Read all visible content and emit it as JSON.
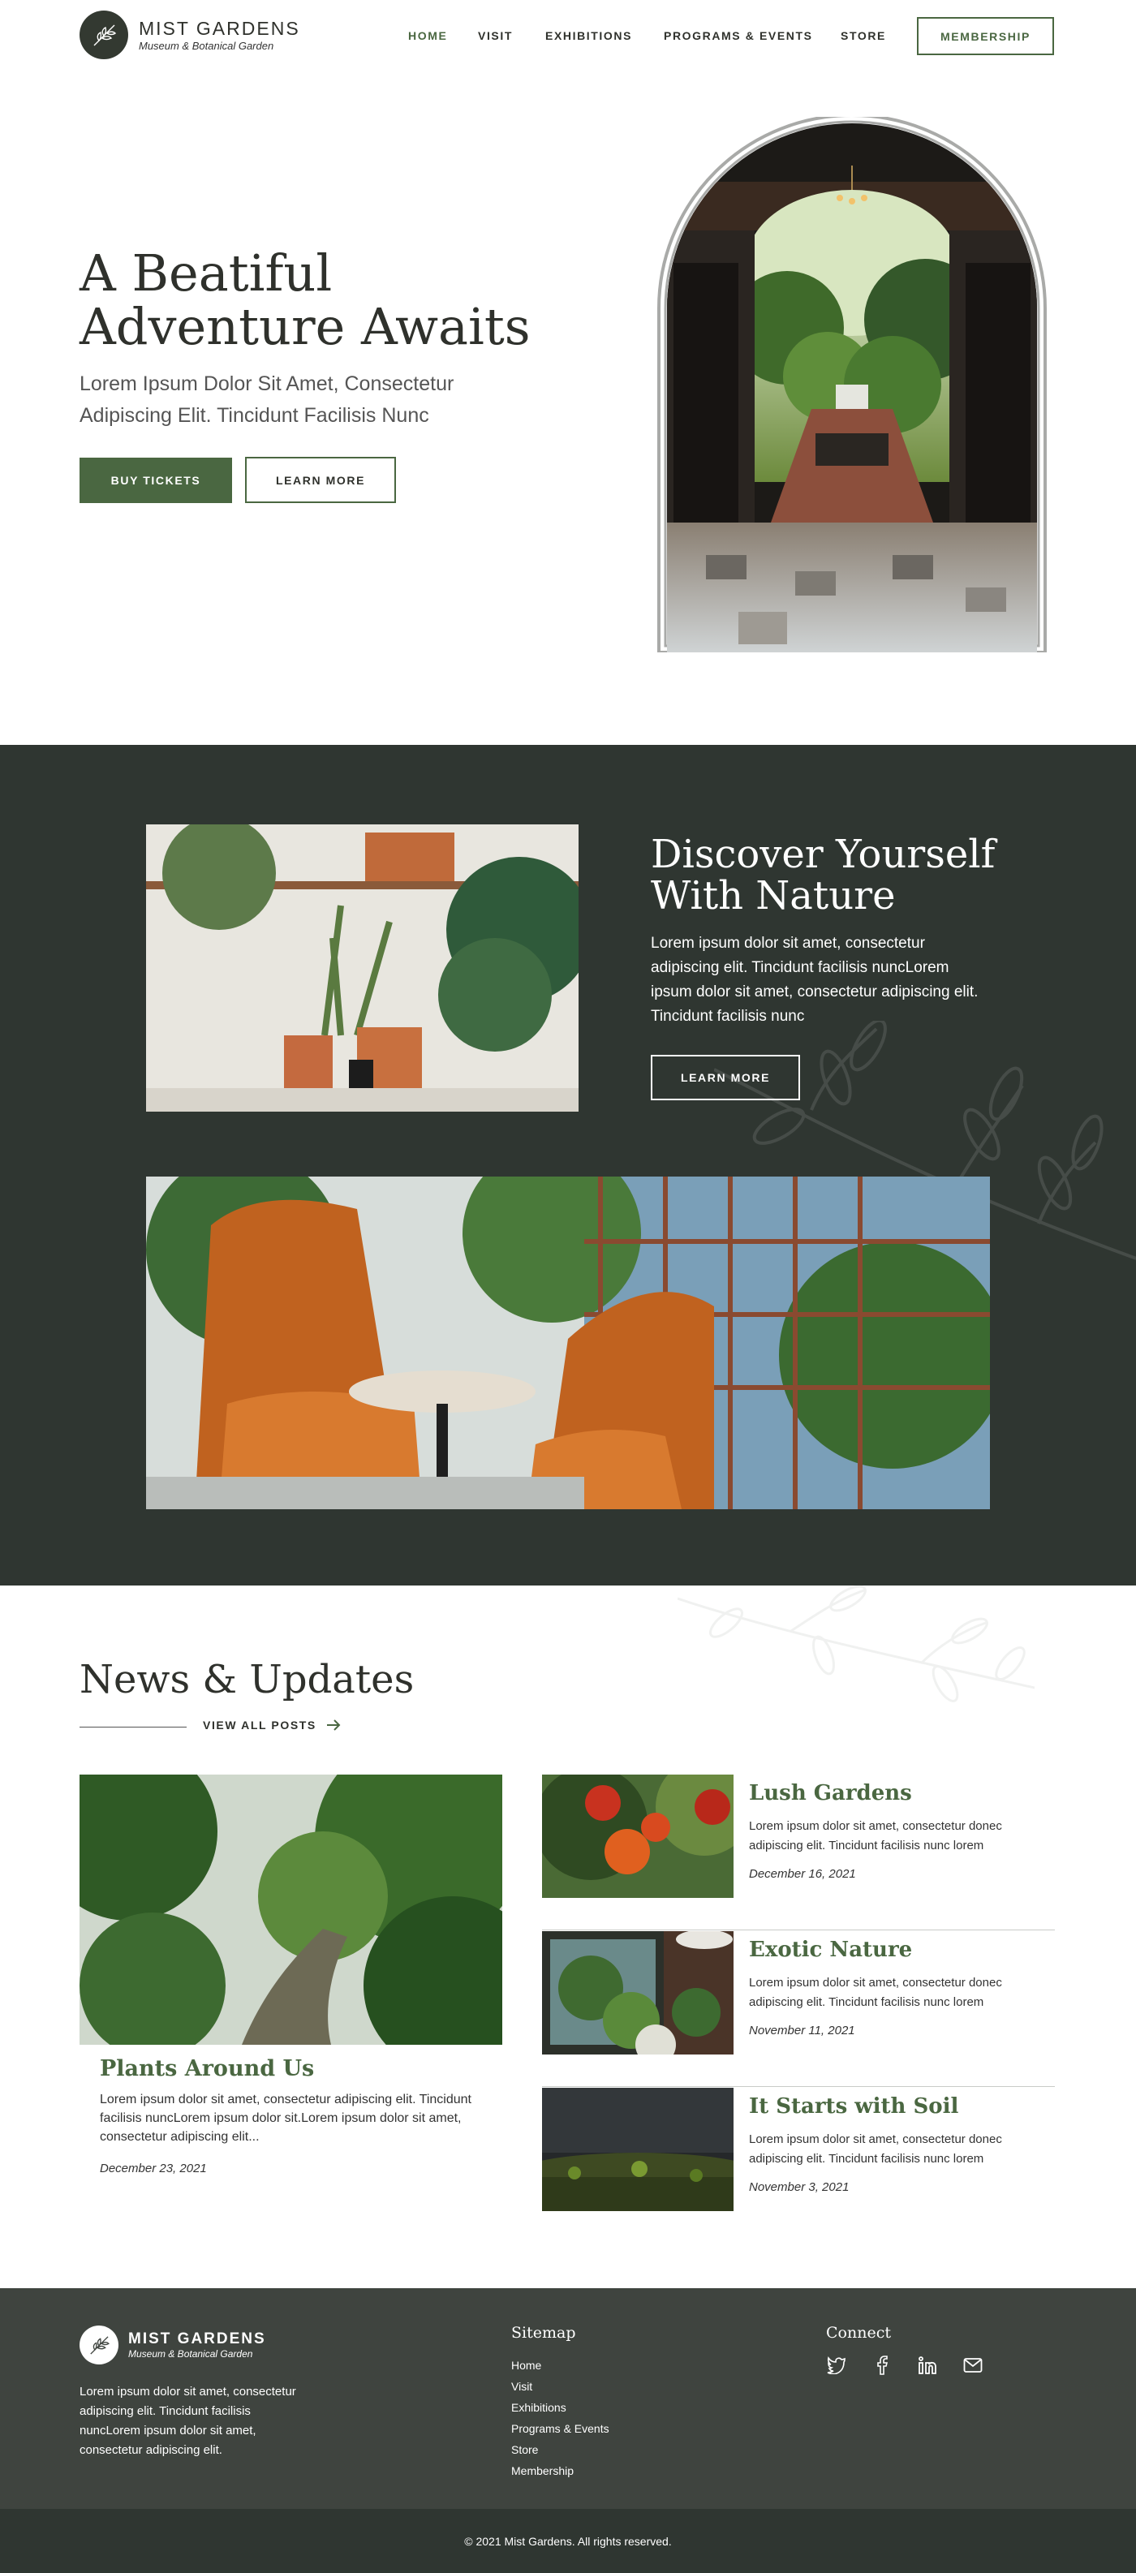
{
  "brand": {
    "name": "MIST GARDENS",
    "tagline": "Museum & Botanical Garden"
  },
  "nav": {
    "items": [
      "HOME",
      "VISIT",
      "EXHIBITIONS",
      "PROGRAMS & EVENTS",
      "STORE"
    ],
    "membership_label": "MEMBERSHIP"
  },
  "hero": {
    "title_line1": "A Beatiful",
    "title_line2": "Adventure Awaits",
    "subtitle": "Lorem Ipsum Dolor Sit Amet, Consectetur Adipiscing Elit. Tincidunt Facilisis Nunc",
    "buy_label": "BUY TICKETS",
    "learn_label": "LEARN MORE"
  },
  "discover": {
    "title_line1": "Discover Yourself",
    "title_line2": "With Nature",
    "text": "Lorem ipsum dolor sit amet, consectetur adipiscing elit. Tincidunt facilisis nuncLorem ipsum dolor sit amet, consectetur adipiscing elit. Tincidunt facilisis nunc",
    "learn_label": "LEARN MORE"
  },
  "news": {
    "title": "News & Updates",
    "view_all": "VIEW ALL POSTS",
    "featured": {
      "title": "Plants Around Us",
      "text": "Lorem ipsum dolor sit amet, consectetur adipiscing elit. Tincidunt facilisis nuncLorem ipsum dolor sit.Lorem ipsum dolor sit amet, consectetur adipiscing elit...",
      "date": "December 23, 2021"
    },
    "posts": [
      {
        "title": "Lush Gardens",
        "text": "Lorem ipsum dolor sit amet, consectetur donec adipiscing elit. Tincidunt facilisis nunc lorem",
        "date": "December 16, 2021"
      },
      {
        "title": "Exotic Nature",
        "text": "Lorem ipsum dolor sit amet, consectetur donec adipiscing elit. Tincidunt facilisis nunc lorem",
        "date": "November 11, 2021"
      },
      {
        "title": "It Starts with Soil",
        "text": "Lorem ipsum dolor sit amet, consectetur donec adipiscing elit. Tincidunt facilisis nunc lorem",
        "date": "November 3, 2021"
      }
    ]
  },
  "footer": {
    "about": "Lorem ipsum dolor sit amet, consectetur adipiscing elit. Tincidunt facilisis nuncLorem ipsum dolor sit amet, consectetur adipiscing elit.",
    "sitemap_heading": "Sitemap",
    "sitemap": [
      "Home",
      "Visit",
      "Exhibitions",
      "Programs & Events",
      "Store",
      "Membership"
    ],
    "connect_heading": "Connect",
    "social_icons": [
      "twitter-icon",
      "facebook-icon",
      "linkedin-icon",
      "mail-icon"
    ],
    "copyright": "© 2021 Mist Gardens. All rights reserved."
  },
  "colors": {
    "accent": "#4a6741",
    "dark": "#2f3631",
    "footer": "#3f443f",
    "text": "#2f312c"
  }
}
